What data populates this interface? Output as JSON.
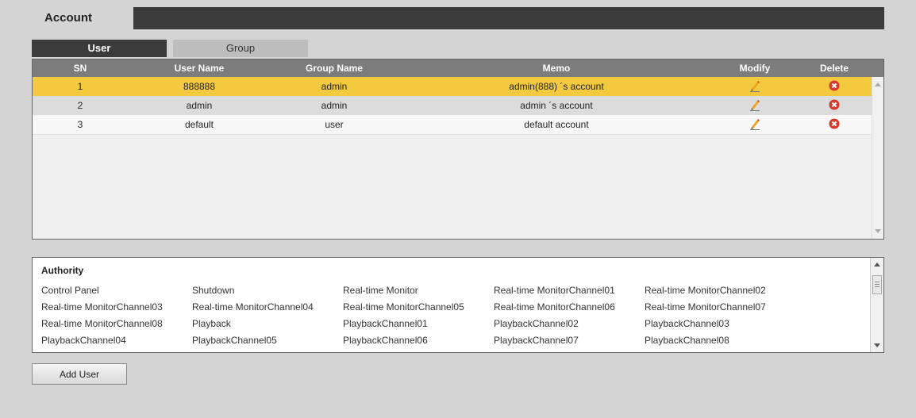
{
  "header": {
    "title": "Account"
  },
  "tabs": [
    {
      "label": "User",
      "active": true
    },
    {
      "label": "Group",
      "active": false
    }
  ],
  "table": {
    "columns": [
      "SN",
      "User Name",
      "Group Name",
      "Memo",
      "Modify",
      "Delete"
    ],
    "rows": [
      {
        "sn": "1",
        "user": "888888",
        "group": "admin",
        "memo": "admin(888) ´s account",
        "selected": true
      },
      {
        "sn": "2",
        "user": "admin",
        "group": "admin",
        "memo": "admin ´s account",
        "selected": false
      },
      {
        "sn": "3",
        "user": "default",
        "group": "user",
        "memo": "default account",
        "selected": false
      }
    ],
    "modify_icon": "pencil-icon",
    "delete_icon": "delete-x-icon"
  },
  "authority": {
    "title": "Authority",
    "items": [
      "Control Panel",
      "Shutdown",
      "Real-time Monitor",
      "Real-time MonitorChannel01",
      "Real-time MonitorChannel02",
      "Real-time MonitorChannel03",
      "Real-time MonitorChannel04",
      "Real-time MonitorChannel05",
      "Real-time MonitorChannel06",
      "Real-time MonitorChannel07",
      "Real-time MonitorChannel08",
      "Playback",
      "PlaybackChannel01",
      "PlaybackChannel02",
      "PlaybackChannel03",
      "PlaybackChannel04",
      "PlaybackChannel05",
      "PlaybackChannel06",
      "PlaybackChannel07",
      "PlaybackChannel08"
    ]
  },
  "add_user_label": "Add User",
  "colors": {
    "selected_row": "#f3c93d",
    "header_dark": "#3b3b3b",
    "table_header": "#7c7c7c",
    "delete_red": "#d9382b"
  }
}
